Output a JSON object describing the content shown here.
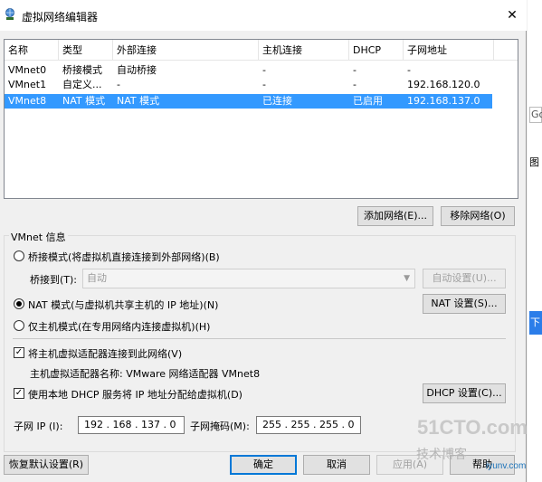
{
  "window": {
    "title": "虚拟网络编辑器",
    "close_glyph": "✕"
  },
  "network_list": {
    "columns": [
      "名称",
      "类型",
      "外部连接",
      "主机连接",
      "DHCP",
      "子网地址"
    ],
    "rows": [
      {
        "name": "VMnet0",
        "type": "桥接模式",
        "external": "自动桥接",
        "host": "-",
        "dhcp": "-",
        "subnet": "-"
      },
      {
        "name": "VMnet1",
        "type": "自定义...",
        "external": "-",
        "host": "-",
        "dhcp": "-",
        "subnet": "192.168.120.0"
      },
      {
        "name": "VMnet8",
        "type": "NAT 模式",
        "external": "NAT 模式",
        "host": "已连接",
        "dhcp": "已启用",
        "subnet": "192.168.137.0"
      }
    ],
    "selected_row": 2
  },
  "list_buttons": {
    "add": "添加网络(E)...",
    "remove": "移除网络(O)"
  },
  "vmnet_info": {
    "label": "VMnet 信息",
    "bridged_label": "桥接模式(将虚拟机直接连接到外部网络)(B)",
    "bridged_to_label": "桥接到(T):",
    "bridged_to_value": "自动",
    "auto_settings": "自动设置(U)...",
    "nat_label": "NAT 模式(与虚拟机共享主机的 IP 地址)(N)",
    "nat_settings": "NAT 设置(S)...",
    "hostonly_label": "仅主机模式(在专用网络内连接虚拟机)(H)",
    "mode_selected": "nat",
    "connect_adapter_label": "将主机虚拟适配器连接到此网络(V)",
    "connect_adapter_checked": true,
    "adapter_name_text": "主机虚拟适配器名称: VMware 网络适配器 VMnet8",
    "use_dhcp_label": "使用本地 DHCP 服务将 IP 地址分配给虚拟机(D)",
    "use_dhcp_checked": true,
    "dhcp_settings": "DHCP 设置(C)...",
    "subnet_ip_label": "子网 IP (I):",
    "subnet_ip_value": "192 . 168 . 137 . 0",
    "subnet_mask_label": "子网掩码(M):",
    "subnet_mask_value": "255 . 255 . 255 . 0"
  },
  "footer": {
    "restore_defaults": "恢复默认设置(R)",
    "ok": "确定",
    "cancel": "取消",
    "apply": "应用(A)",
    "help": "帮助"
  },
  "background": {
    "go_fragment": "Go",
    "tu_fragment": "图",
    "blue_fragment": "下"
  },
  "watermark": {
    "line1": "51CTO.com",
    "line2": "技术博客",
    "line3": "iyunv.com"
  },
  "colors": {
    "selection": "#3399ff",
    "primary_border": "#0078d7"
  }
}
